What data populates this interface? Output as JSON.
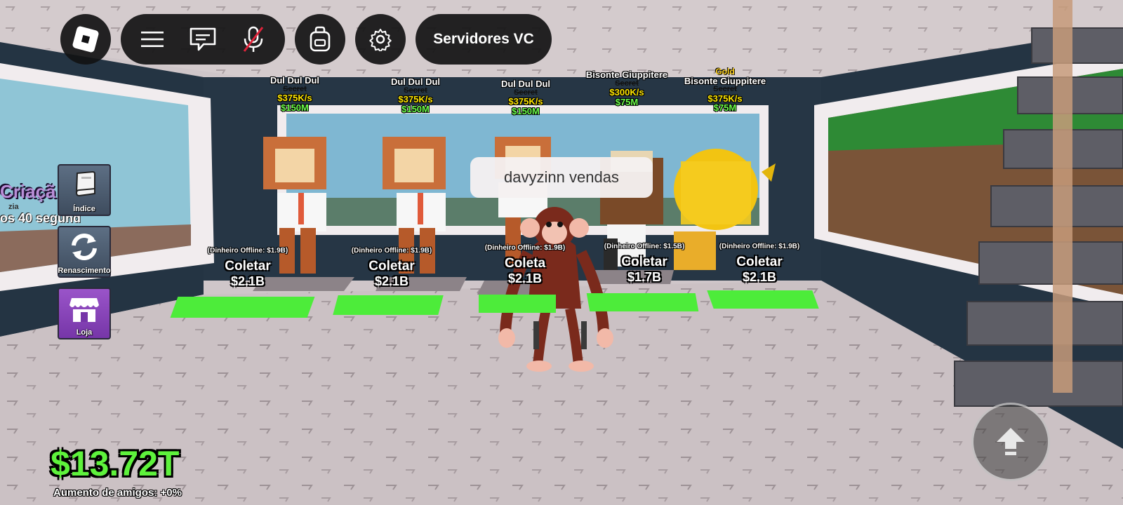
{
  "top_bar": {
    "servers_label": "Servidores VC",
    "icons": [
      "roblox-logo-icon",
      "hamburger-menu-icon",
      "chat-icon",
      "mic-muted-icon",
      "backpack-icon",
      "gear-icon"
    ]
  },
  "side_menu": [
    {
      "label": "Índice",
      "icon": "book-icon"
    },
    {
      "label": "Renascimento",
      "icon": "refresh-icon"
    },
    {
      "label": "Loja",
      "icon": "shop-icon"
    }
  ],
  "left_sign": {
    "title": "Criaçã",
    "sub": "zia",
    "timer": "os 40 segund"
  },
  "brainrots": [
    {
      "name": "Dul Dul Dul",
      "extra": "",
      "rarity": "Secret",
      "rate": "$375K/s",
      "price": "$150M",
      "offline": "(Dinheiro Offline: $1.9B)",
      "collect": "Coletar",
      "amount": "$2.1B"
    },
    {
      "name": "Dul Dul Dul",
      "extra": "",
      "rarity": "Secret",
      "rate": "$375K/s",
      "price": "$150M",
      "offline": "(Dinheiro Offline: $1.9B)",
      "collect": "Coletar",
      "amount": "$2.1B"
    },
    {
      "name": "Dul Dul Dul",
      "extra": "",
      "rarity": "Secret",
      "rate": "$375K/s",
      "price": "$150M",
      "offline": "(Dinheiro Offline: $1.9B)",
      "collect": "Coleta",
      "amount": "$2.1B"
    },
    {
      "name": "Bisonte Giuppitere",
      "extra": "",
      "rarity": "Secret",
      "rate": "$300K/s",
      "price": "$75M",
      "offline": "(Dinheiro Offline: $1.5B)",
      "collect": "Coletar",
      "amount": "$1.7B"
    },
    {
      "name": "Bisonte Giuppitere",
      "extra": "Gold",
      "rarity": "Secret",
      "rate": "$375K/s",
      "price": "$75M",
      "offline": "(Dinheiro Offline: $1.9B)",
      "collect": "Coletar",
      "amount": "$2.1B"
    }
  ],
  "chat_bubble": "davyzinn vendas",
  "hud": {
    "money": "$13.72T",
    "friend_boost": "Aumento de amigos: +0%"
  },
  "colors": {
    "money_green": "#5ef23c",
    "rate_yellow": "#ffe600",
    "price_green": "#6dff4a",
    "pad_green": "#4dec3a"
  }
}
